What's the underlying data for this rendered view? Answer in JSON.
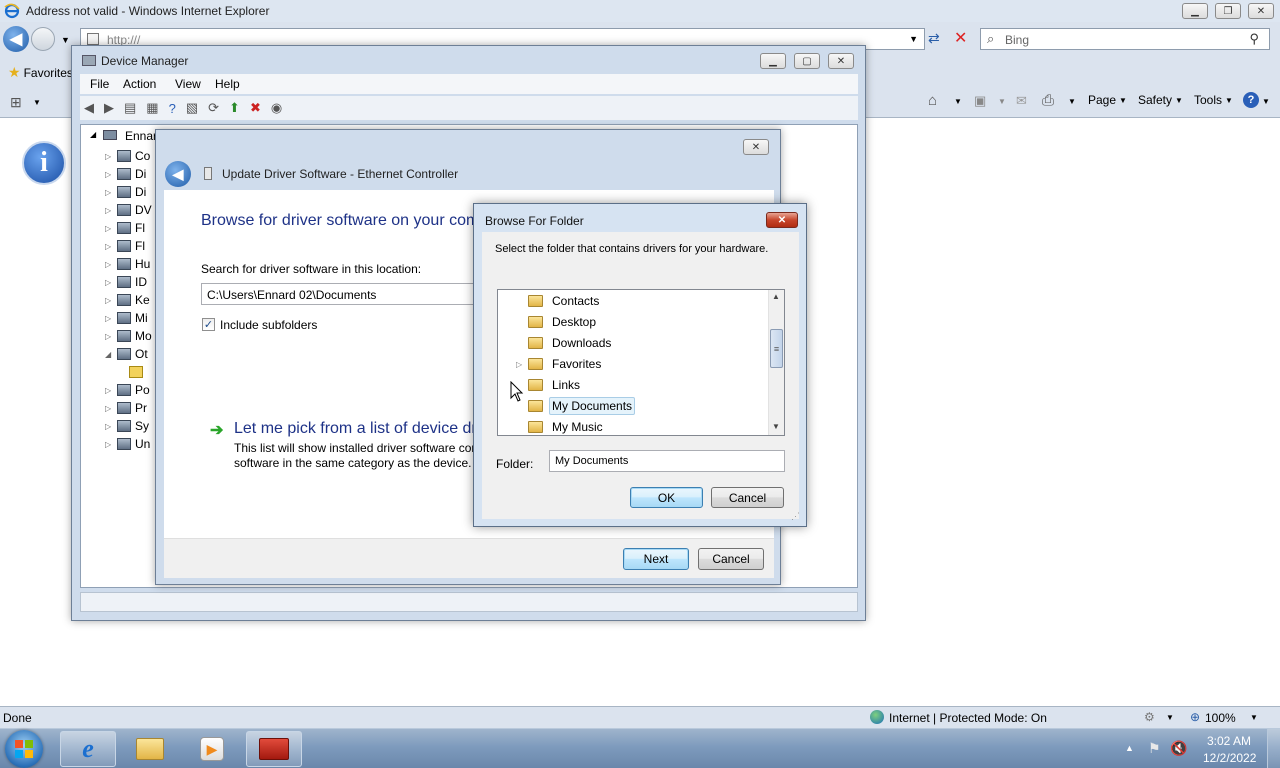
{
  "ie": {
    "title": "Address not valid - Windows Internet Explorer",
    "address": "http:///",
    "search_placeholder": "Bing",
    "favorites_label": "Favorites",
    "cmd": {
      "page": "Page",
      "safety": "Safety",
      "tools": "Tools"
    },
    "status_left": "Done",
    "status_zone": "Internet | Protected Mode: On",
    "zoom": "100%"
  },
  "devmgr": {
    "title": "Device Manager",
    "menu": [
      "File",
      "Action",
      "View",
      "Help"
    ],
    "tree_root": "Ennar",
    "tree_items": [
      "Co",
      "Di",
      "Di",
      "DV",
      "Fl",
      "Fl",
      "Hu",
      "ID",
      "Ke",
      "Mi",
      "Mo",
      "Ot",
      "",
      "Po",
      "Pr",
      "Sy",
      "Un"
    ]
  },
  "wizard": {
    "title": "Update Driver Software - Ethernet Controller",
    "heading": "Browse for driver software on your com",
    "search_label": "Search for driver software in this location:",
    "path_value": "C:\\Users\\Ennard 02\\Documents",
    "include_subfolders": "Include subfolders",
    "include_checked": true,
    "pick_title": "Let me pick from a list of device dri",
    "pick_desc1": "This list will show installed driver software cor",
    "pick_desc2": "software in the same category as the device.",
    "next": "Next",
    "cancel": "Cancel"
  },
  "browse": {
    "title": "Browse For Folder",
    "instruction": "Select the folder that contains drivers for your hardware.",
    "folders": [
      {
        "name": "Contacts",
        "expandable": false,
        "selected": false
      },
      {
        "name": "Desktop",
        "expandable": false,
        "selected": false
      },
      {
        "name": "Downloads",
        "expandable": false,
        "selected": false
      },
      {
        "name": "Favorites",
        "expandable": true,
        "selected": false
      },
      {
        "name": "Links",
        "expandable": false,
        "selected": false
      },
      {
        "name": "My Documents",
        "expandable": false,
        "selected": true
      },
      {
        "name": "My Music",
        "expandable": false,
        "selected": false
      }
    ],
    "folder_label": "Folder:",
    "folder_value": "My Documents",
    "ok": "OK",
    "cancel": "Cancel"
  },
  "taskbar": {
    "time": "3:02 AM",
    "date": "12/2/2022"
  },
  "colors": {
    "ie_frame": "#dbe3ee",
    "wizard_heading": "#1e3287",
    "taskbar": "#7e9bbd",
    "selected_item": "#e5f3fb"
  }
}
